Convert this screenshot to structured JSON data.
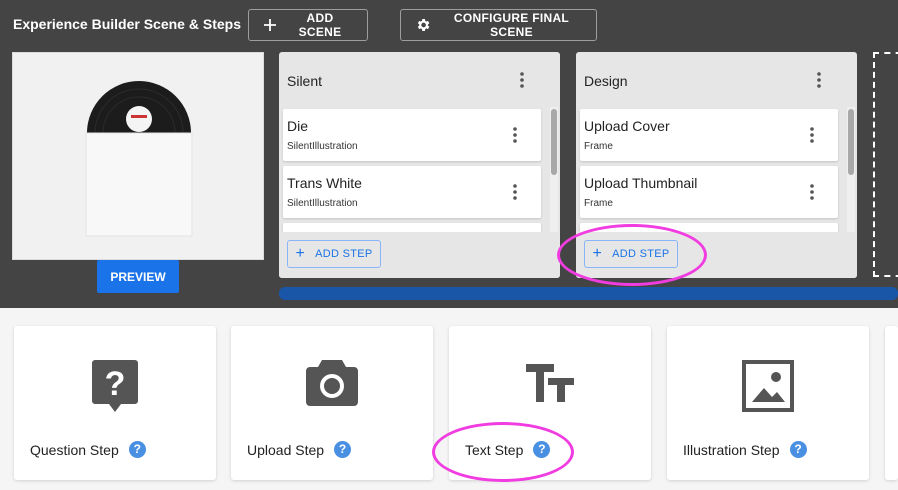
{
  "header": {
    "title": "Experience Builder Scene & Steps",
    "add_scene_label": "ADD SCENE",
    "configure_final_scene_label": "CONFIGURE FINAL SCENE"
  },
  "preview": {
    "button_label": "PREVIEW"
  },
  "scenes": [
    {
      "name": "Silent",
      "steps": [
        {
          "name": "Die",
          "type": "SilentIllustration"
        },
        {
          "name": "Trans White",
          "type": "SilentIllustration"
        }
      ],
      "add_step_label": "ADD STEP"
    },
    {
      "name": "Design",
      "steps": [
        {
          "name": "Upload Cover",
          "type": "Frame"
        },
        {
          "name": "Upload Thumbnail",
          "type": "Frame"
        }
      ],
      "add_step_label": "ADD STEP"
    }
  ],
  "step_types": [
    {
      "label": "Question Step",
      "icon": "question-icon"
    },
    {
      "label": "Upload Step",
      "icon": "camera-icon"
    },
    {
      "label": "Text Step",
      "icon": "text-icon"
    },
    {
      "label": "Illustration Step",
      "icon": "image-icon"
    }
  ],
  "help_glyph": "?",
  "colors": {
    "top_bg": "#444444",
    "accent": "#1a73e8",
    "highlight": "#f03ce0",
    "help": "#4a90e2"
  }
}
